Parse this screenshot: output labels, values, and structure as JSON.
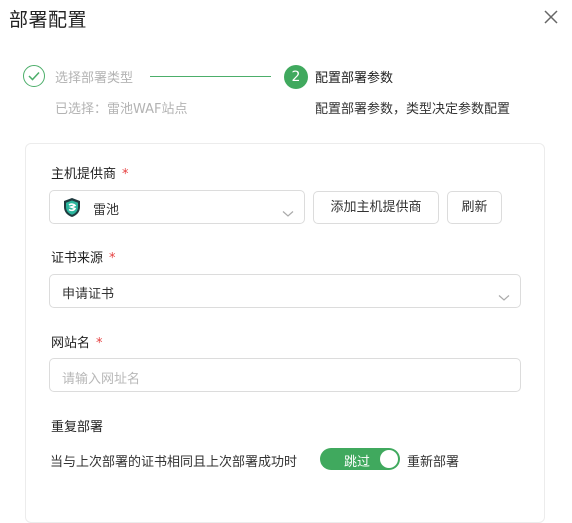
{
  "dialog": {
    "title": "部署配置"
  },
  "steps": [
    {
      "title": "选择部署类型",
      "desc": "已选择：雷池WAF站点",
      "status": "done"
    },
    {
      "number": "2",
      "title": "配置部署参数",
      "desc": "配置部署参数，类型决定参数配置",
      "status": "active"
    }
  ],
  "form": {
    "host_provider": {
      "label": "主机提供商",
      "required_mark": "*",
      "value": "雷池",
      "icon": "safeline-logo-icon",
      "add_button": "添加主机提供商",
      "refresh_button": "刷新"
    },
    "cert_source": {
      "label": "证书来源",
      "required_mark": "*",
      "value": "申请证书"
    },
    "site_name": {
      "label": "网站名",
      "required_mark": "*",
      "placeholder": "请输入网址名"
    },
    "redeploy": {
      "label": "重复部署",
      "condition_text": "当与上次部署的证书相同且上次部署成功时",
      "toggle_label": "跳过",
      "toggle_on": true,
      "after_text": "重新部署"
    }
  },
  "colors": {
    "accent": "#40a95e",
    "required": "#e53e3e"
  }
}
